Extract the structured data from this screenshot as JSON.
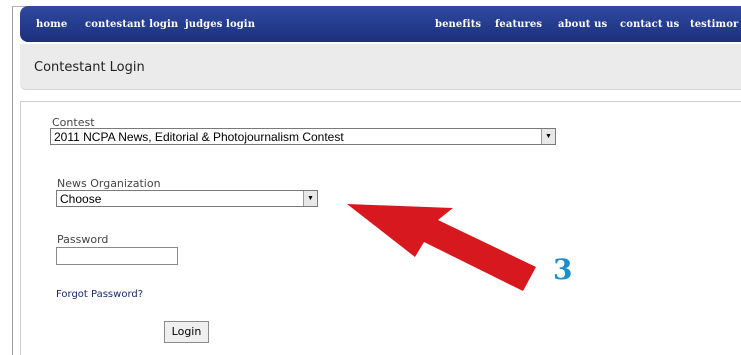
{
  "nav": {
    "items": [
      "home",
      "contestant login",
      "judges login",
      "benefits",
      "features",
      "about us",
      "contact us",
      "testimor"
    ]
  },
  "page": {
    "title": "Contestant Login"
  },
  "form": {
    "contest_label": "Contest",
    "contest_value": "2011 NCPA News, Editorial & Photojournalism Contest",
    "org_label": "News Organization",
    "org_value": "Choose",
    "password_label": "Password",
    "password_value": "",
    "forgot_link": "Forgot Password?",
    "login_button": "Login"
  },
  "annotation": {
    "step_number": "3",
    "arrow_color": "#d7191f",
    "number_color": "#1a8fc9"
  }
}
